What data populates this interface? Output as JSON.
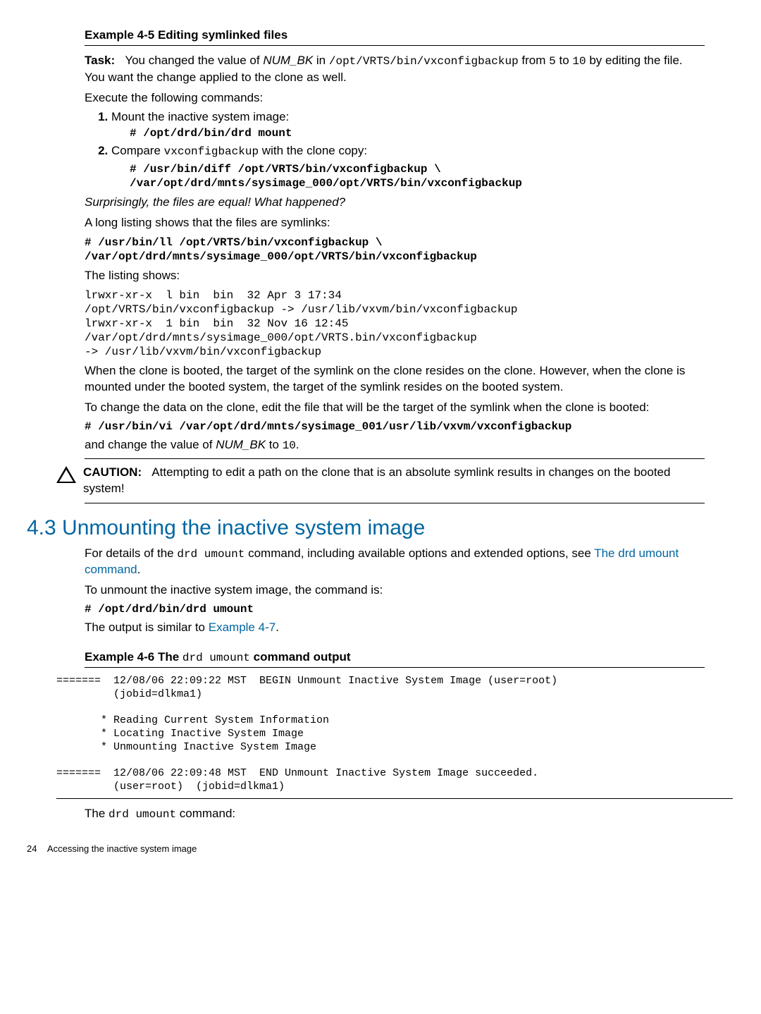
{
  "example45": {
    "title": "Example 4-5 Editing symlinked files",
    "task_label": "Task:",
    "task_pre": "You changed the value of ",
    "task_var": "NUM_BK",
    "task_mid1": " in ",
    "task_code1": "/opt/VRTS/bin/vxconfigbackup",
    "task_mid2": " from ",
    "task_code2": "5",
    "task_mid3": " to ",
    "task_code3": "10",
    "task_end": " by editing the file. You want the change applied to the clone as well.",
    "execute": "Execute the following commands:",
    "step1": "Mount the inactive system image:",
    "step1_code": "# /opt/drd/bin/drd mount",
    "step2_pre": "Compare ",
    "step2_code_inline": "vxconfigbackup",
    "step2_post": " with the clone copy:",
    "step2_code": "# /usr/bin/diff /opt/VRTS/bin/vxconfigbackup \\\n/var/opt/drd/mnts/sysimage_000/opt/VRTS/bin/vxconfigbackup",
    "surprising": "Surprisingly, the files are equal! What happened?",
    "longlisting": "A long listing shows that the files are symlinks:",
    "ll_cmd": "# /usr/bin/ll /opt/VRTS/bin/vxconfigbackup \\\n/var/opt/drd/mnts/sysimage_000/opt/VRTS/bin/vxconfigbackup",
    "listing_shows": "The listing shows:",
    "listing": "lrwxr-xr-x  l bin  bin  32 Apr 3 17:34\n/opt/VRTS/bin/vxconfigbackup -> /usr/lib/vxvm/bin/vxconfigbackup\nlrwxr-xr-x  1 bin  bin  32 Nov 16 12:45\n/var/opt/drd/mnts/sysimage_000/opt/VRTS.bin/vxconfigbackup\n-> /usr/lib/vxvm/bin/vxconfigbackup",
    "when_clone": "When the clone is booted, the target of the symlink on the clone resides on the clone. However, when the clone is mounted under the booted system, the target of the symlink resides on the booted system.",
    "to_change": "To change the data on the clone, edit the file that will be the target of the symlink when the clone is booted:",
    "vi_cmd": "# /usr/bin/vi /var/opt/drd/mnts/sysimage_001/usr/lib/vxvm/vxconfigbackup",
    "and_change_pre": "and change the value of ",
    "and_change_var": "NUM_BK",
    "and_change_mid": " to ",
    "and_change_val": "10",
    "and_change_end": "."
  },
  "caution": {
    "label": "CAUTION:",
    "text": "Attempting to edit a path on the clone that is an absolute symlink results in changes on the booted system!"
  },
  "section43": {
    "heading": "4.3 Unmounting the inactive system image",
    "p1_pre": "For details of the ",
    "p1_code": "drd umount",
    "p1_mid": " command, including available options and extended options, see ",
    "p1_link": "The drd umount command",
    "p1_end": ".",
    "p2": "To unmount the inactive system image, the command is:",
    "cmd": "# /opt/drd/bin/drd umount",
    "p3_pre": "The output is similar to ",
    "p3_link": "Example 4-7",
    "p3_end": "."
  },
  "example46": {
    "title_pre": "Example 4-6 The ",
    "title_code": "drd umount",
    "title_post": " command output",
    "output": "=======  12/08/06 22:09:22 MST  BEGIN Unmount Inactive System Image (user=root)\n         (jobid=dlkma1)\n\n       * Reading Current System Information\n       * Locating Inactive System Image\n       * Unmounting Inactive System Image\n\n=======  12/08/06 22:09:48 MST  END Unmount Inactive System Image succeeded.\n         (user=root)  (jobid=dlkma1)"
  },
  "trailing": {
    "pre": "The ",
    "code": "drd umount",
    "post": " command:"
  },
  "footer": {
    "page": "24",
    "section": "Accessing the inactive system image"
  }
}
